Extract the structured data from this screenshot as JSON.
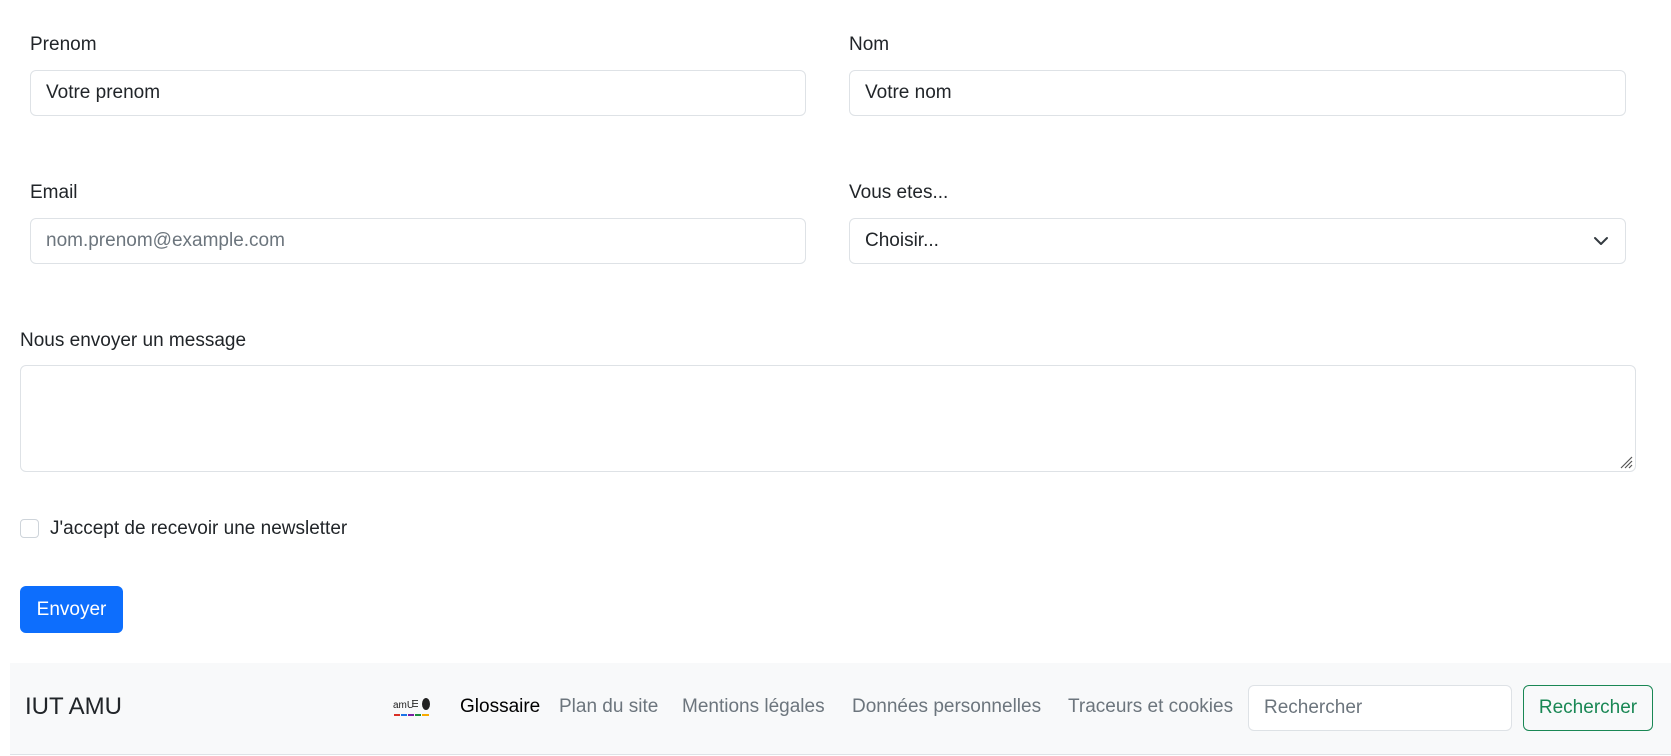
{
  "form": {
    "prenom": {
      "label": "Prenom",
      "value": "Votre prenom"
    },
    "nom": {
      "label": "Nom",
      "value": "Votre nom"
    },
    "email": {
      "label": "Email",
      "placeholder": "nom.prenom@example.com"
    },
    "role": {
      "label": "Vous etes...",
      "selected": "Choisir..."
    },
    "message": {
      "label": "Nous envoyer un message",
      "value": ""
    },
    "newsletter": {
      "label": "J'accept de recevoir une newsletter",
      "checked": false
    },
    "submit_label": "Envoyer"
  },
  "footer": {
    "brand": "IUT AMU",
    "links": [
      {
        "label": "Glossaire",
        "active": true
      },
      {
        "label": "Plan du site",
        "active": false
      },
      {
        "label": "Mentions légales",
        "active": false
      },
      {
        "label": "Données personnelles",
        "active": false
      },
      {
        "label": "Traceurs et cookies",
        "active": false
      }
    ],
    "search": {
      "placeholder": "Rechercher",
      "button_label": "Rechercher"
    }
  },
  "colors": {
    "primary": "#0d6efd",
    "success": "#198754",
    "footer_bg": "#f8f9fa",
    "border": "#dee2e6"
  }
}
